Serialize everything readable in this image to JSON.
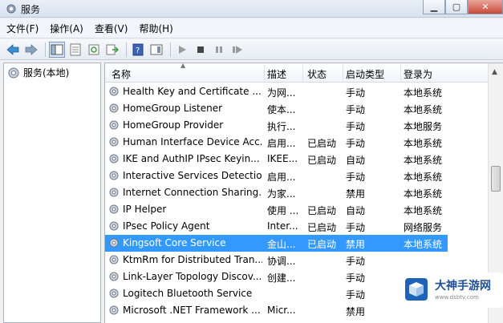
{
  "window": {
    "title": "服务",
    "blurred_title": ""
  },
  "menubar": [
    "文件(F)",
    "操作(A)",
    "查看(V)",
    "帮助(H)"
  ],
  "toolbar": {
    "buttons": [
      "back-icon",
      "forward-icon",
      "show-hide-tree-icon",
      "properties-icon",
      "refresh-icon",
      "export-icon",
      "help-icon",
      "action-pane-icon",
      "play-icon",
      "stop-icon",
      "pause-icon",
      "restart-icon"
    ]
  },
  "tree": {
    "root_label": "服务(本地)"
  },
  "columns": {
    "name": "名称",
    "desc": "描述",
    "status": "状态",
    "start": "启动类型",
    "logon": "登录为"
  },
  "services": [
    {
      "name": "Health Key and Certificate ...",
      "desc": "为网...",
      "status": "",
      "start": "手动",
      "logon": "本地系统"
    },
    {
      "name": "HomeGroup Listener",
      "desc": "使本...",
      "status": "",
      "start": "手动",
      "logon": "本地系统"
    },
    {
      "name": "HomeGroup Provider",
      "desc": "执行...",
      "status": "",
      "start": "手动",
      "logon": "本地服务"
    },
    {
      "name": "Human Interface Device Acc...",
      "desc": "启用...",
      "status": "已启动",
      "start": "手动",
      "logon": "本地系统"
    },
    {
      "name": "IKE and AuthIP IPsec Keyin...",
      "desc": "IKEE...",
      "status": "已启动",
      "start": "自动",
      "logon": "本地系统"
    },
    {
      "name": "Interactive Services Detection",
      "desc": "启用...",
      "status": "",
      "start": "手动",
      "logon": "本地系统"
    },
    {
      "name": "Internet Connection Sharing...",
      "desc": "为家...",
      "status": "",
      "start": "禁用",
      "logon": "本地系统"
    },
    {
      "name": "IP Helper",
      "desc": "使用 ...",
      "status": "已启动",
      "start": "自动",
      "logon": "本地系统"
    },
    {
      "name": "IPsec Policy Agent",
      "desc": "Inter...",
      "status": "已启动",
      "start": "手动",
      "logon": "网络服务"
    },
    {
      "name": "Kingsoft Core Service",
      "desc": "金山...",
      "status": "已启动",
      "start": "禁用",
      "logon": "本地系统",
      "selected": true
    },
    {
      "name": "KtmRm for Distributed Tran...",
      "desc": "协调...",
      "status": "",
      "start": "手动",
      "logon": ""
    },
    {
      "name": "Link-Layer Topology Discov...",
      "desc": "创建...",
      "status": "",
      "start": "手动",
      "logon": ""
    },
    {
      "name": "Logitech Bluetooth Service",
      "desc": "",
      "status": "",
      "start": "手动",
      "logon": ""
    },
    {
      "name": "Microsoft .NET Framework ...",
      "desc": "Micr...",
      "status": "",
      "start": "禁用",
      "logon": ""
    }
  ],
  "watermark": {
    "title": "大神手游网",
    "url": "www.dsbtv.com"
  },
  "colors": {
    "selection": "#3399ff",
    "titlebar": "#dbe6f4"
  }
}
